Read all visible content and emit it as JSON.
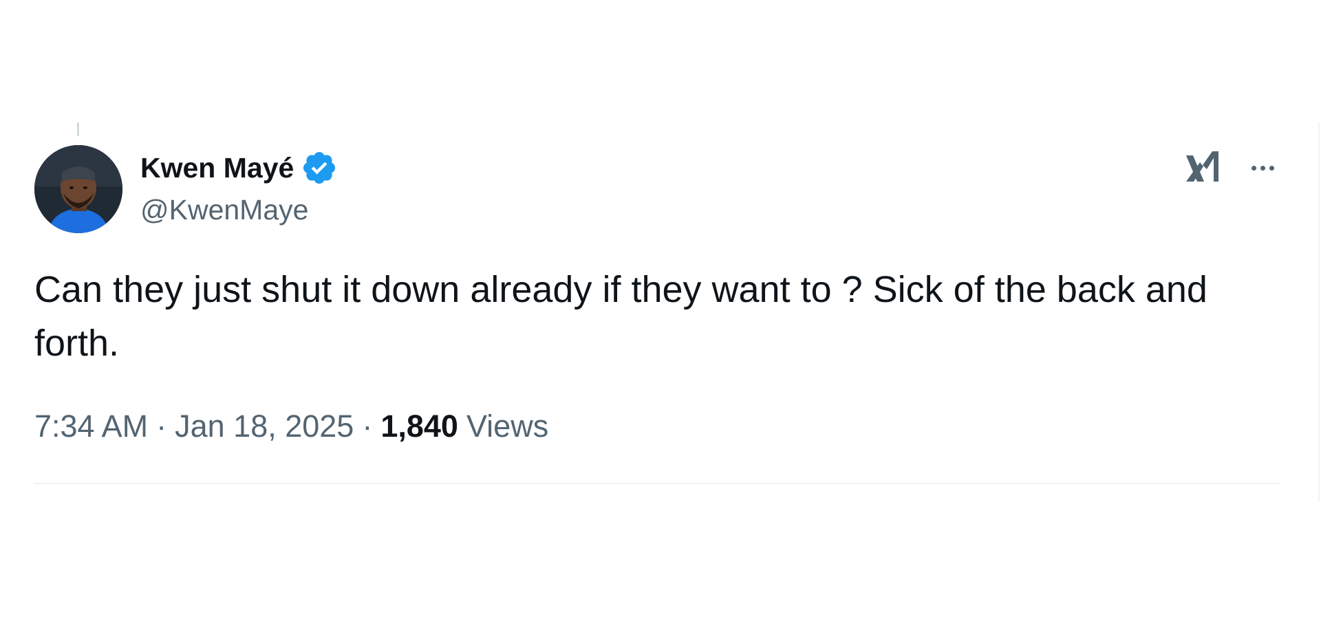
{
  "author": {
    "display_name": "Kwen Mayé",
    "handle": "@KwenMaye",
    "verified": true
  },
  "tweet": {
    "text": "Can they just shut it down already if they want to ? Sick of the back and forth.",
    "time": "7:34 AM",
    "separator": "·",
    "date": "Jan 18, 2025",
    "views_count": "1,840",
    "views_label": "Views"
  },
  "icons": {
    "brand": "x-logo-icon",
    "menu": "more-icon",
    "badge": "verified-badge-icon"
  },
  "colors": {
    "text_primary": "#0f1419",
    "text_secondary": "#536471",
    "verified_blue": "#1d9bf0",
    "divider": "#eff3f4"
  }
}
